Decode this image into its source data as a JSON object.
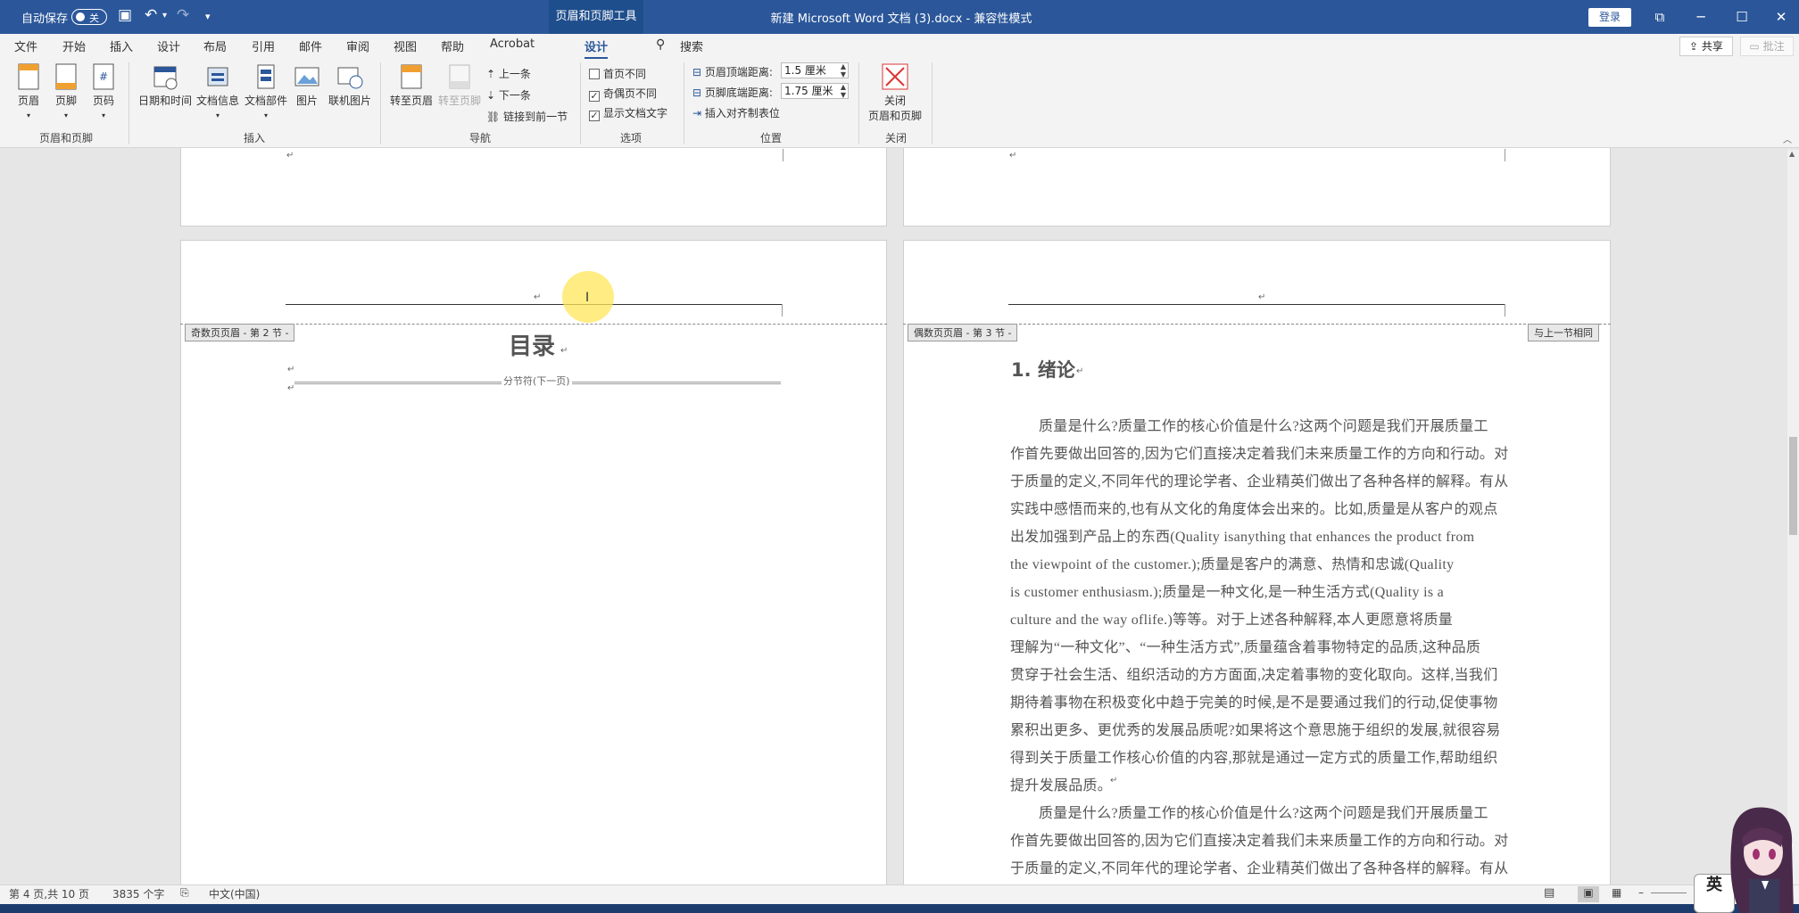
{
  "titlebar": {
    "autosave_label": "自动保存",
    "autosave_state": "关",
    "context_tab": "页眉和页脚工具",
    "document_title": "新建 Microsoft Word 文档 (3).docx  -  兼容性模式",
    "login_label": "登录"
  },
  "tabs": [
    {
      "label": "文件"
    },
    {
      "label": "开始"
    },
    {
      "label": "插入"
    },
    {
      "label": "设计"
    },
    {
      "label": "布局"
    },
    {
      "label": "引用"
    },
    {
      "label": "邮件"
    },
    {
      "label": "审阅"
    },
    {
      "label": "视图"
    },
    {
      "label": "帮助"
    },
    {
      "label": "Acrobat"
    },
    {
      "label": "设计"
    }
  ],
  "search_label": "搜索",
  "share_label": "共享",
  "comments_label": "批注",
  "ribbon": {
    "hf_group": {
      "label": "页眉和页脚",
      "header": "页眉",
      "footer": "页脚",
      "page_number": "页码"
    },
    "insert_group": {
      "label": "插入",
      "datetime": "日期和时间",
      "docinfo": "文档信息",
      "quickparts": "文档部件",
      "picture": "图片",
      "online_picture": "联机图片"
    },
    "nav_group": {
      "label": "导航",
      "goto_header": "转至页眉",
      "goto_footer": "转至页脚",
      "previous": "上一条",
      "next": "下一条",
      "link_previous": "链接到前一节"
    },
    "options_group": {
      "label": "选项",
      "first_page_diff": "首页不同",
      "odd_even_diff": "奇偶页不同",
      "show_doc_text": "显示文档文字"
    },
    "position_group": {
      "label": "位置",
      "header_top_label": "页眉顶端距离:",
      "header_top_value": "1.5 厘米",
      "footer_bottom_label": "页脚底端距离:",
      "footer_bottom_value": "1.75 厘米",
      "insert_align_tab": "插入对齐制表位"
    },
    "close_group": {
      "label": "关闭",
      "close_line1": "关闭",
      "close_line2": "页眉和页脚"
    }
  },
  "document": {
    "left_header_tag": "奇数页页眉 - 第 2 节 -",
    "right_header_tag": "偶数页页眉 - 第 3 节 -",
    "same_as_previous": "与上一节相同",
    "toc_title": "目录",
    "section_break": "分节符(下一页)",
    "chapter_title": "1. 绪论",
    "body_lines": [
      "质量是什么?质量工作的核心价值是什么?这两个问题是我们开展质量工",
      "作首先要做出回答的,因为它们直接决定着我们未来质量工作的方向和行动。对",
      "于质量的定义,不同年代的理论学者、企业精英们做出了各种各样的解释。有从",
      "实践中感悟而来的,也有从文化的角度体会出来的。比如,质量是从客户的观点",
      "出发加强到产品上的东西(Quality isanything that enhances the product from",
      "the viewpoint of the customer.);质量是客户的满意、热情和忠诚(Quality",
      "is customer enthusiasm.);质量是一种文化,是一种生活方式(Quality is a",
      "culture and the way oflife.)等等。对于上述各种解释,本人更愿意将质量",
      "理解为“一种文化”、“一种生活方式”,质量蕴含着事物特定的品质,这种品质",
      "贯穿于社会生活、组织活动的方方面面,决定着事物的变化取向。这样,当我们",
      "期待着事物在积极变化中趋于完美的时候,是不是要通过我们的行动,促使事物",
      "累积出更多、更优秀的发展品质呢?如果将这个意思施于组织的发展,就很容易",
      "得到关于质量工作核心价值的内容,那就是通过一定方式的质量工作,帮助组织",
      "提升发展品质。",
      "质量是什么?质量工作的核心价值是什么?这两个问题是我们开展质量工",
      "作首先要做出回答的,因为它们直接决定着我们未来质量工作的方向和行动。对",
      "于质量的定义,不同年代的理论学者、企业精英们做出了各种各样的解释。有从"
    ]
  },
  "statusbar": {
    "page_info": "第 4 页,共 10 页",
    "word_count": "3835 个字",
    "language": "中文(中国)"
  },
  "ime": {
    "label": "英"
  }
}
